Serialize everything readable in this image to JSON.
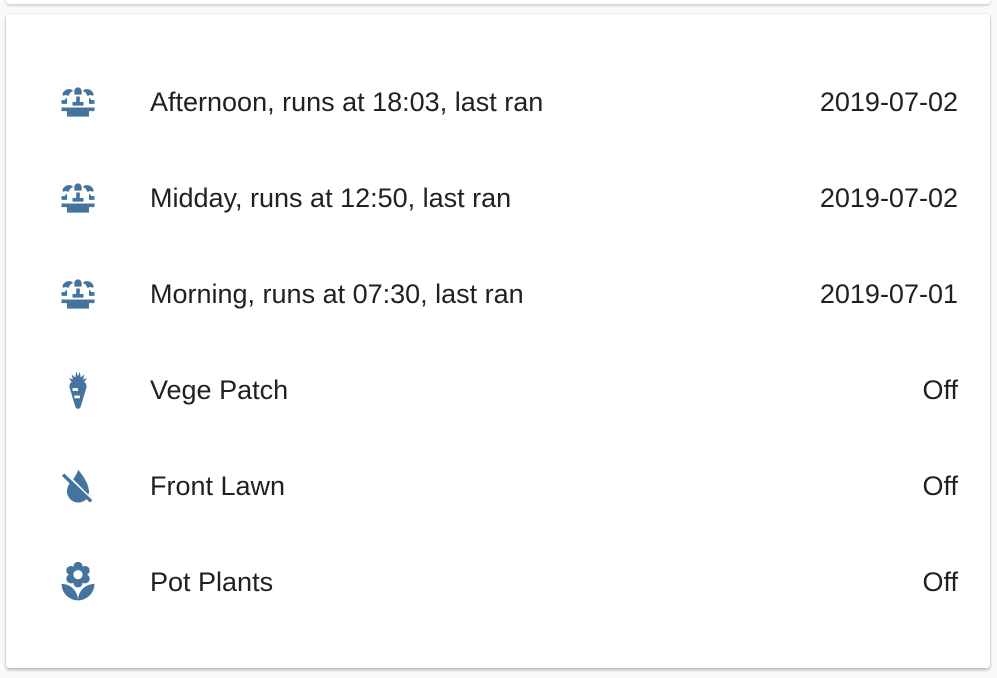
{
  "colors": {
    "icon": "#44739e",
    "text": "#212121",
    "card": "#ffffff"
  },
  "entities": [
    {
      "icon": "fountain-icon",
      "name": "Afternoon, runs at 18:03, last ran",
      "state": "2019-07-02"
    },
    {
      "icon": "fountain-icon",
      "name": "Midday, runs at 12:50, last ran",
      "state": "2019-07-02"
    },
    {
      "icon": "fountain-icon",
      "name": "Morning, runs at 07:30, last ran",
      "state": "2019-07-01"
    },
    {
      "icon": "carrot-icon",
      "name": "Vege Patch",
      "state": "Off"
    },
    {
      "icon": "water-off-icon",
      "name": "Front Lawn",
      "state": "Off"
    },
    {
      "icon": "flower-icon",
      "name": "Pot Plants",
      "state": "Off"
    }
  ]
}
